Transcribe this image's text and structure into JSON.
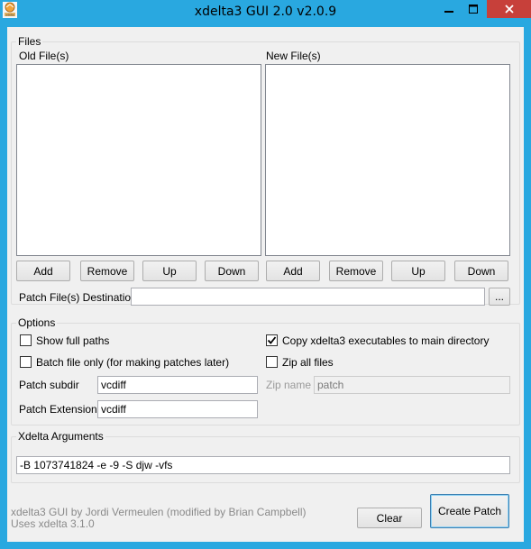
{
  "window": {
    "title": "xdelta3 GUI 2.0  v2.0.9",
    "icons": {
      "app": "xdelta3-app-icon",
      "minimize": "minimize-icon",
      "maximize": "maximize-icon",
      "close": "close-icon"
    },
    "colors": {
      "titlebar": "#29a8e0",
      "close_button": "#c7403a",
      "client": "#f0f0f0"
    }
  },
  "files": {
    "group_label": "Files",
    "old_label": "Old File(s)",
    "new_label": "New File(s)",
    "old_buttons": {
      "add": "Add",
      "remove": "Remove",
      "up": "Up",
      "down": "Down"
    },
    "new_buttons": {
      "add": "Add",
      "remove": "Remove",
      "up": "Up",
      "down": "Down"
    },
    "destination_label": "Patch File(s) Destination",
    "destination_value": "",
    "browse_label": "..."
  },
  "options": {
    "group_label": "Options",
    "show_full_paths": {
      "label": "Show full paths",
      "checked": false
    },
    "batch_only": {
      "label": "Batch file only (for making patches later)",
      "checked": false
    },
    "copy_executables": {
      "label": "Copy xdelta3 executables to main directory",
      "checked": true
    },
    "zip_all": {
      "label": "Zip all files",
      "checked": false
    },
    "patch_subdir_label": "Patch subdir",
    "patch_subdir_value": "vcdiff",
    "patch_extension_label": "Patch Extension",
    "patch_extension_value": "vcdiff",
    "zip_name_label": "Zip name",
    "zip_name_value": "patch"
  },
  "arguments": {
    "group_label": "Xdelta Arguments",
    "value": "-B 1073741824 -e -9 -S djw -vfs"
  },
  "footer": {
    "credit": "xdelta3 GUI by Jordi Vermeulen (modified by Brian Campbell)",
    "version": "Uses xdelta 3.1.0",
    "clear_label": "Clear",
    "create_label": "Create Patch"
  }
}
